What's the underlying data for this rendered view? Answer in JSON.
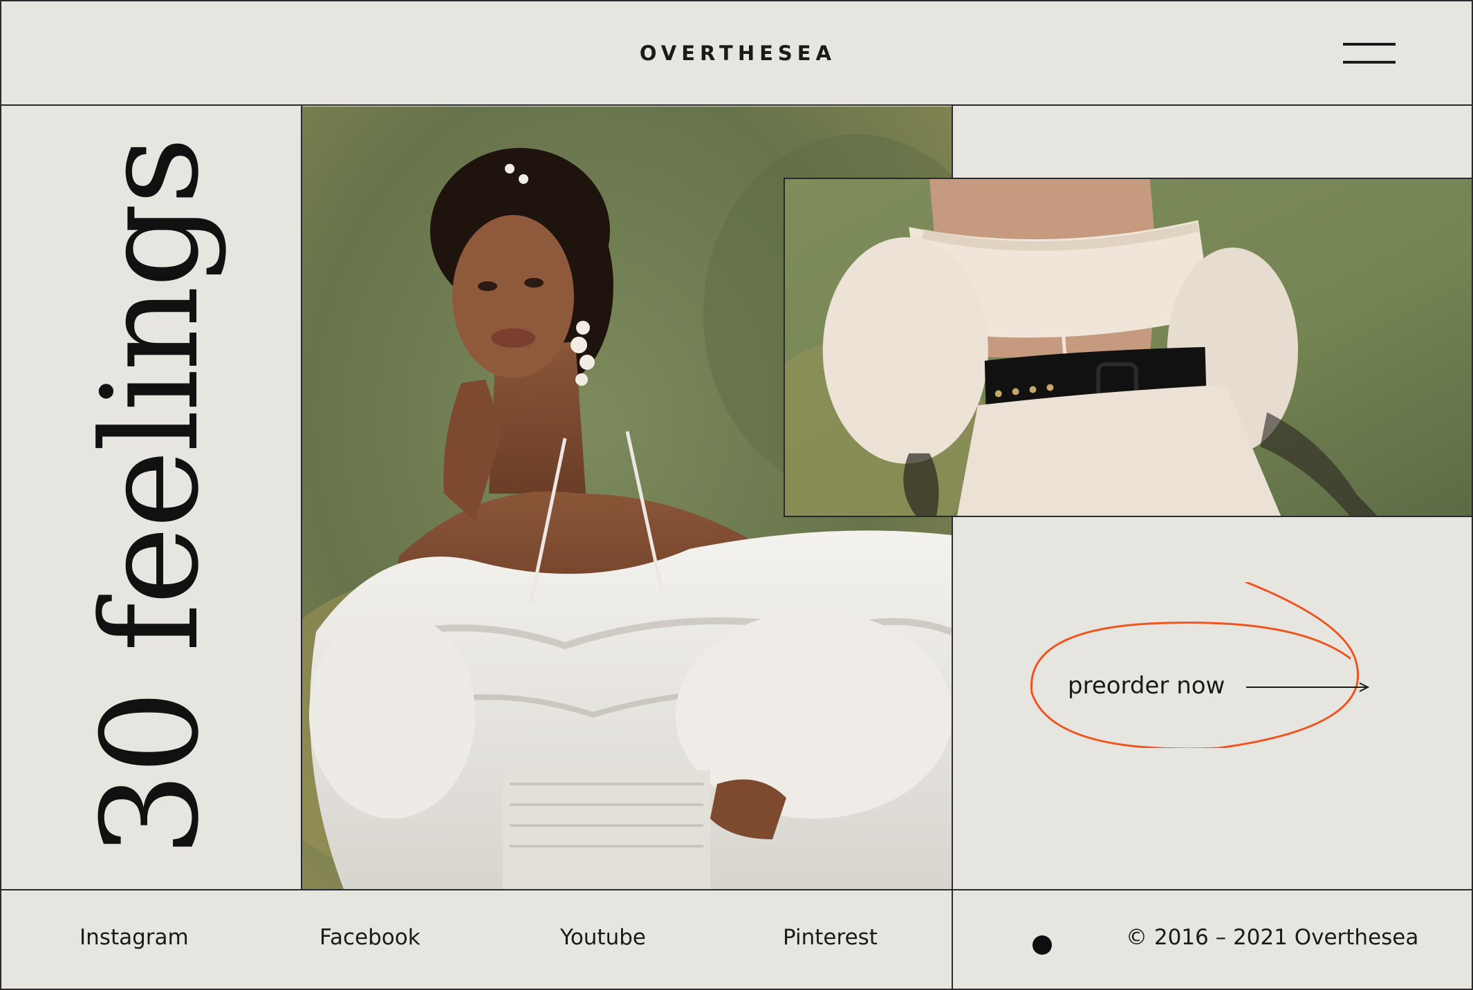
{
  "header": {
    "brand": "OVERTHESEA",
    "menu_icon": "hamburger-icon"
  },
  "hero": {
    "vertical_title": "30 feelings"
  },
  "cta": {
    "label": "preorder now",
    "arrow_icon": "arrow-right-icon",
    "accent_color": "#f0541e"
  },
  "footer": {
    "links": [
      "Instagram",
      "Facebook",
      "Youtube",
      "Pinterest"
    ],
    "copyright": "© 2016 – 2021 Overthesea"
  },
  "colors": {
    "background": "#e7e5e0",
    "lines": "#2a2a2a",
    "text": "#1a1a1a",
    "accent": "#f0541e"
  }
}
